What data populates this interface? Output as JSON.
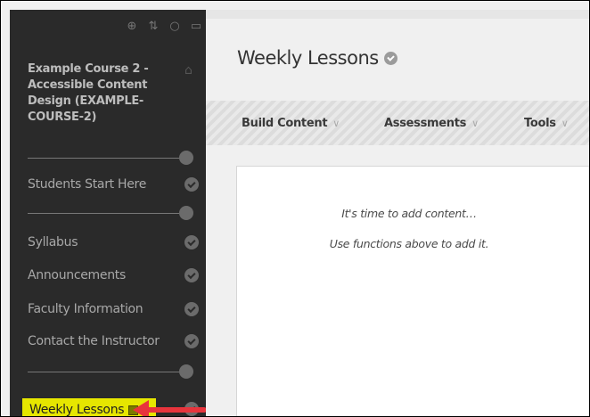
{
  "sidebar": {
    "toolbar_icons": [
      "add-icon",
      "sort-icon",
      "refresh-icon",
      "folder-icon"
    ],
    "course_title": "Example Course 2 - Accessible Content Design (EXAMPLE-COURSE-2)",
    "items": [
      {
        "label": "Students Start Here"
      },
      {
        "label": "Syllabus"
      },
      {
        "label": "Announcements"
      },
      {
        "label": "Faculty Information"
      },
      {
        "label": "Contact the Instructor"
      }
    ],
    "active_item": {
      "label": "Weekly Lessons",
      "highlight_color": "#e6e600"
    },
    "annotation_arrow_color": "#e8343c"
  },
  "main": {
    "page_title": "Weekly Lessons",
    "actions": [
      {
        "label": "Build Content"
      },
      {
        "label": "Assessments"
      },
      {
        "label": "Tools"
      }
    ],
    "empty_line_1": "It's time to add content…",
    "empty_line_2": "Use functions above to add it."
  }
}
